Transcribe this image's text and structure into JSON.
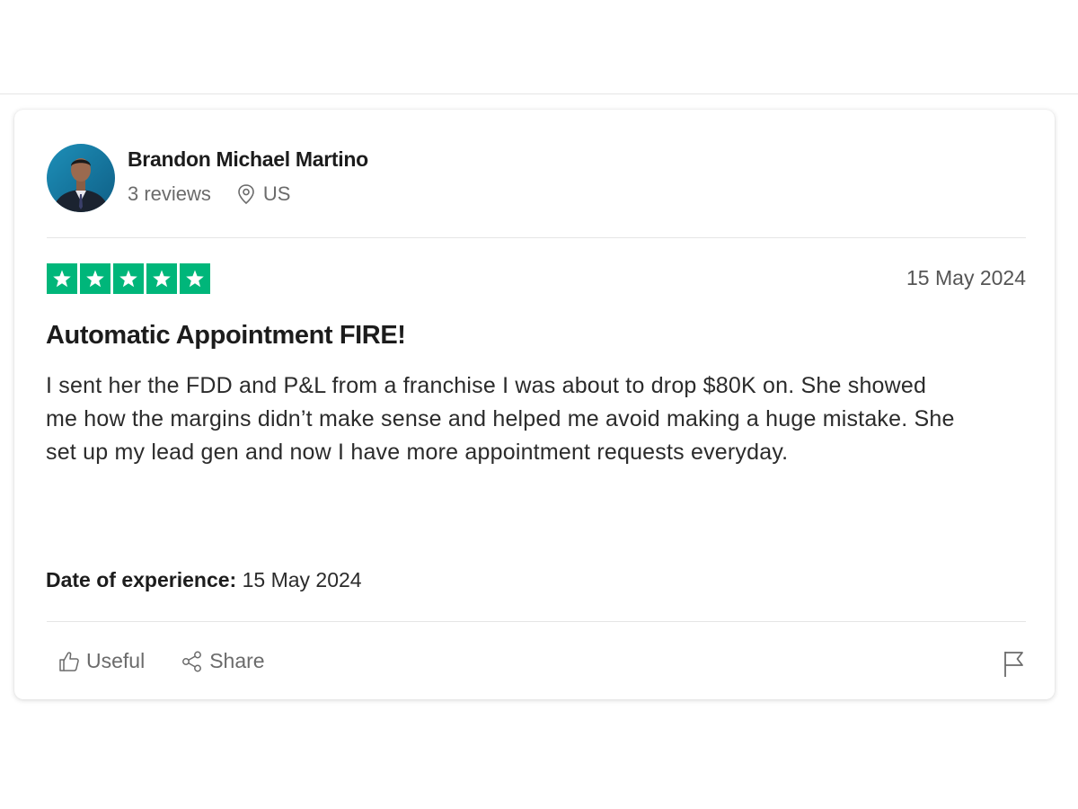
{
  "reviewer": {
    "name": "Brandon Michael Martino",
    "reviews_count": "3 reviews",
    "location": "US",
    "avatar_icon": "avatar-photo"
  },
  "review": {
    "rating": 5,
    "rating_max": 5,
    "star_color": "#00b67a",
    "date": "15 May 2024",
    "title": "Automatic Appointment FIRE!",
    "body": "I sent her the FDD and P&L from a franchise I was about to drop $80K on. She showed me how the margins didn’t make sense and helped me avoid making a huge mistake. She set up my lead gen and now I have more appointment requests everyday.",
    "experience_label": "Date of experience:",
    "experience_date": "15 May 2024"
  },
  "actions": {
    "useful_label": "Useful",
    "useful_icon": "thumbs-up-icon",
    "share_label": "Share",
    "share_icon": "share-icon",
    "flag_icon": "flag-icon"
  }
}
